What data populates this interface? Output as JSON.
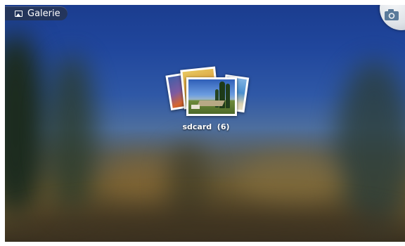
{
  "app_bar": {
    "title": "Galerie",
    "icon": "gallery-icon"
  },
  "camera_button": {
    "icon": "camera-icon"
  },
  "albums": [
    {
      "name": "sdcard",
      "count": "(6)",
      "label": "sdcard  (6)"
    }
  ],
  "colors": {
    "sky": "#20469c",
    "ground": "#6a5a33",
    "bar": "#283246"
  }
}
